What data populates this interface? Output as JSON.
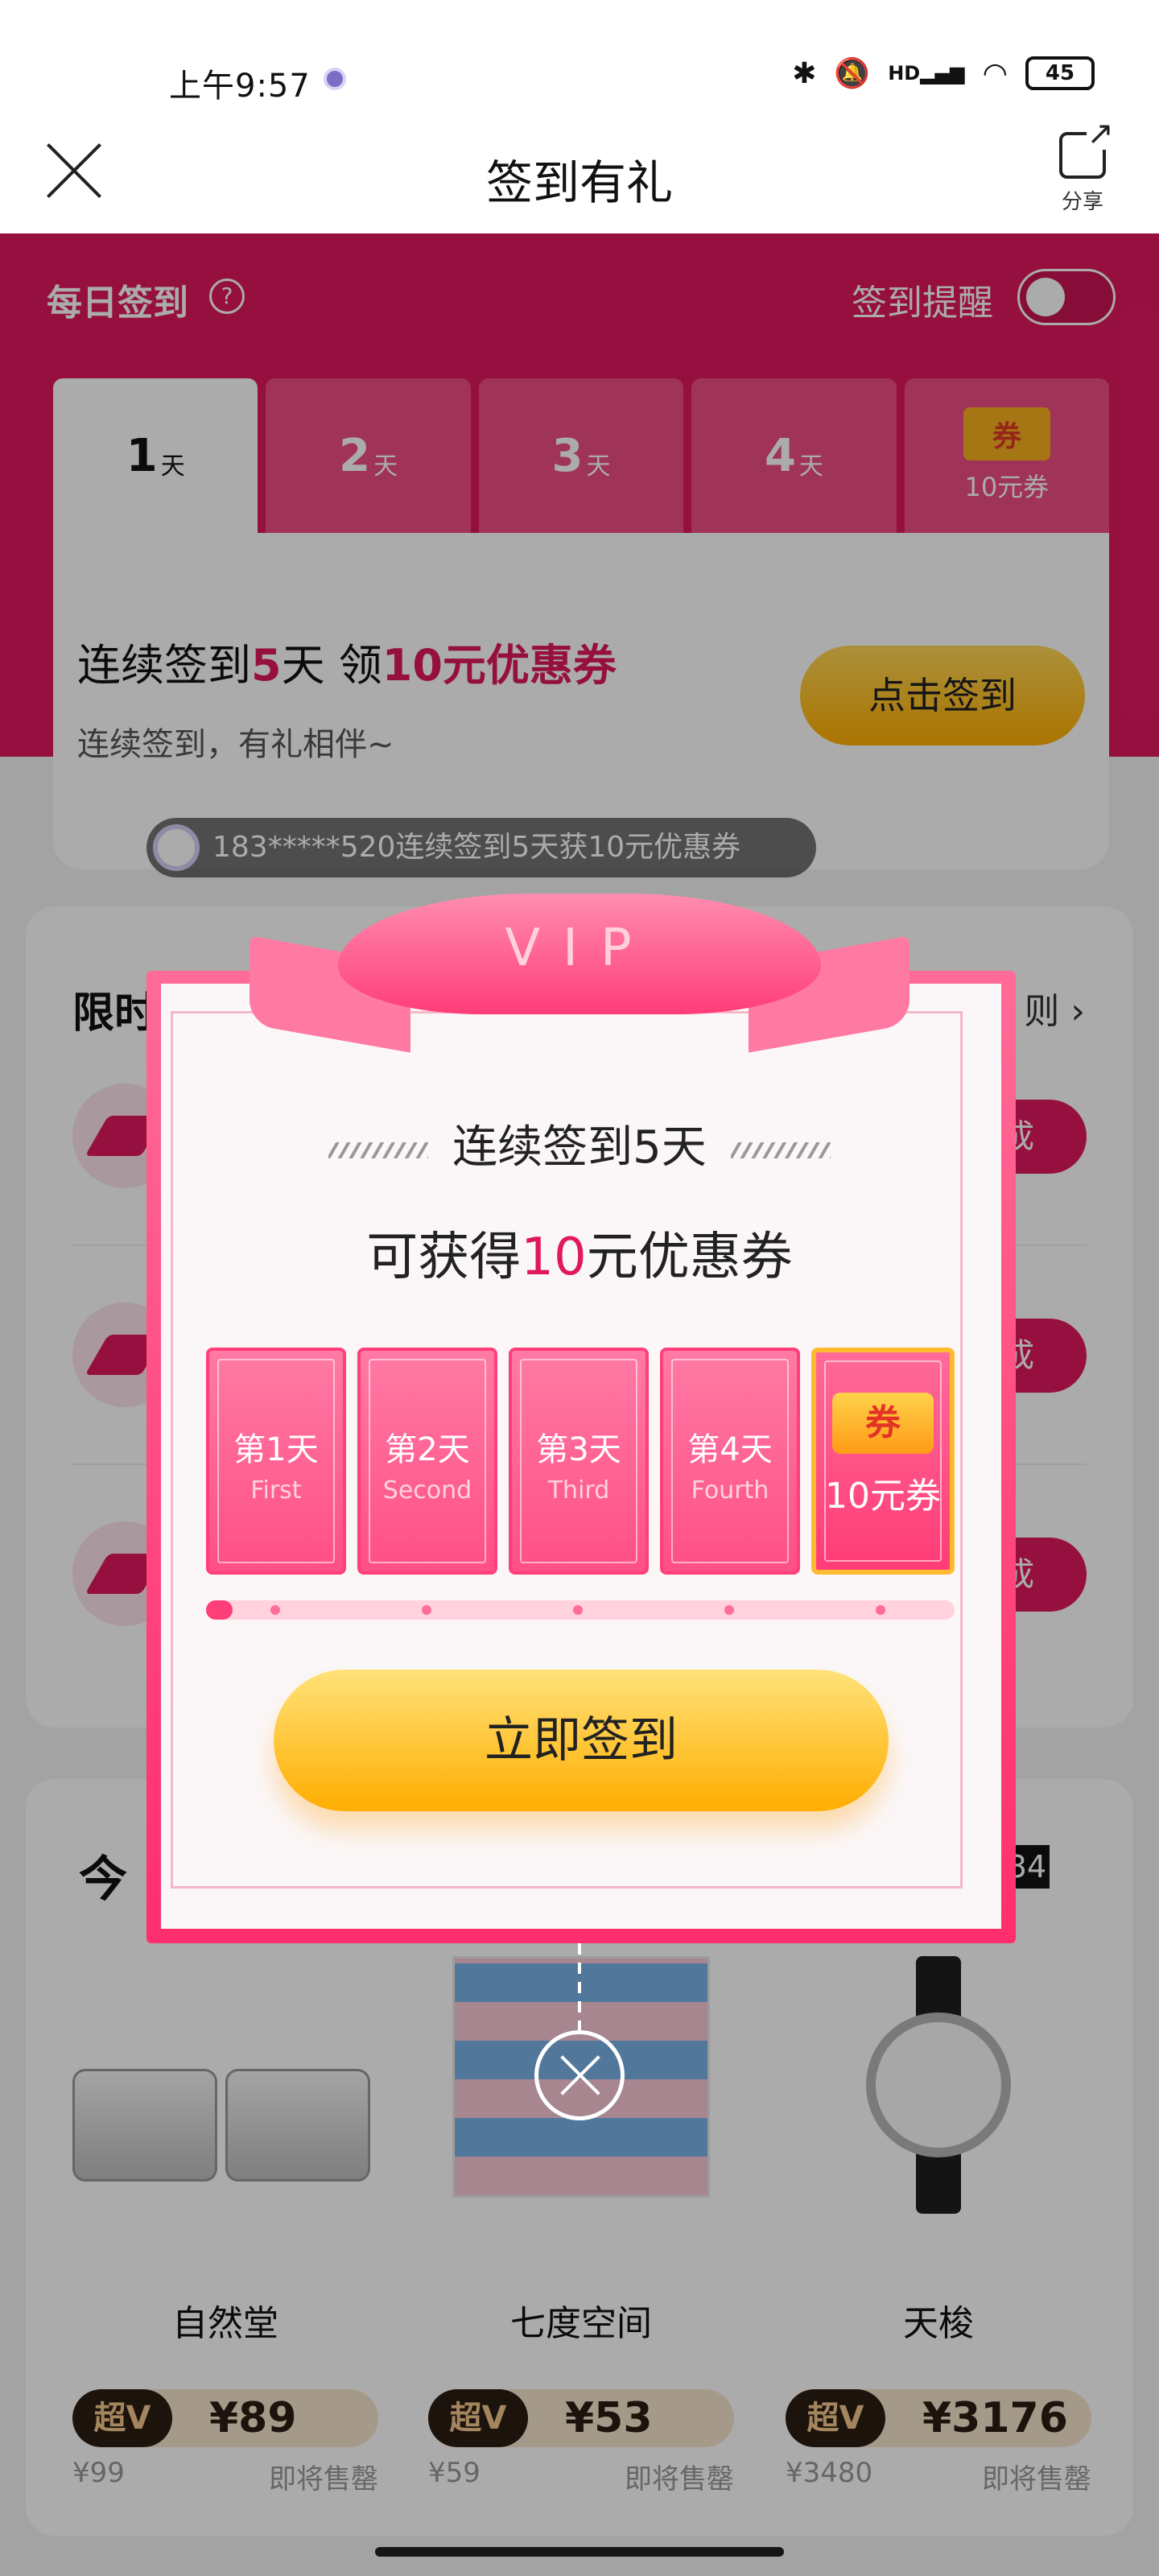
{
  "status": {
    "time": "上午9:57",
    "network": "HD",
    "battery": "45"
  },
  "nav": {
    "title": "签到有礼",
    "share_label": "分享"
  },
  "daily": {
    "title": "每日签到",
    "help": "?",
    "remind_label": "签到提醒",
    "remind_on": false,
    "tabs": [
      {
        "num": "1",
        "unit": "天",
        "active": true
      },
      {
        "num": "2",
        "unit": "天"
      },
      {
        "num": "3",
        "unit": "天"
      },
      {
        "num": "4",
        "unit": "天"
      }
    ],
    "reward_tab": {
      "coupon": "券",
      "label": "10元券"
    },
    "headline": {
      "a": "连续签到",
      "days": "5",
      "b": "天 领",
      "amount": "10元优惠券"
    },
    "sub": "连续签到，有礼相伴~",
    "sign_button": "点击签到",
    "marquee": "183*****520连续签到5天获10元优惠券"
  },
  "tasks": {
    "title": "限时",
    "rule": "则 ›",
    "go_label": "成"
  },
  "today": {
    "title": "今",
    "countdown": "34",
    "products": [
      {
        "name": "自然堂",
        "badge": "超V",
        "price": "¥89",
        "orig": "¥99",
        "status": "即将售罄"
      },
      {
        "name": "七度空间",
        "badge": "超V",
        "price": "¥53",
        "orig": "¥59",
        "status": "即将售罄"
      },
      {
        "name": "天梭",
        "badge": "超V",
        "price": "¥3176",
        "orig": "¥3480",
        "status": "即将售罄"
      }
    ]
  },
  "modal": {
    "ribbon": "VIP",
    "line1": "连续签到5天",
    "line2_a": "可获得",
    "line2_amount": "10",
    "line2_b": "元优惠券",
    "days": [
      {
        "cn": "第1天",
        "en": "First"
      },
      {
        "cn": "第2天",
        "en": "Second"
      },
      {
        "cn": "第3天",
        "en": "Third"
      },
      {
        "cn": "第4天",
        "en": "Fourth"
      }
    ],
    "reward": {
      "coupon": "券",
      "label": "10元券"
    },
    "progress": 0.02,
    "button": "立即签到"
  }
}
